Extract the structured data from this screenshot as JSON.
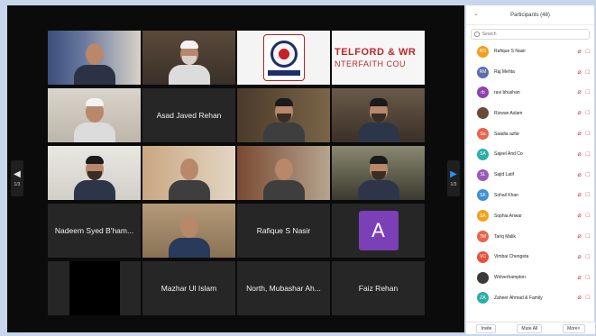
{
  "participants_panel": {
    "title": "Participants (48)",
    "search_placeholder": "Search",
    "participants": [
      {
        "initials": "RS",
        "name": "Rafique S Nasir",
        "color": "#f0a11c"
      },
      {
        "initials": "RM",
        "name": "Raj Mehta",
        "color": "#5b6ea8"
      },
      {
        "initials": "rb",
        "name": "ravi bhushan",
        "color": "#8e44ad"
      },
      {
        "initials": "",
        "name": "Rizwan Aslam",
        "color": "#6b4a3a"
      },
      {
        "initials": "Sa",
        "name": "Saadia azfar",
        "color": "#e8644a"
      },
      {
        "initials": "SA",
        "name": "Sajeel And Co",
        "color": "#2bb0a5"
      },
      {
        "initials": "SL",
        "name": "Sajid Latif",
        "color": "#9b59b6"
      },
      {
        "initials": "SK",
        "name": "Sohail Khan",
        "color": "#3f8fd6"
      },
      {
        "initials": "SA",
        "name": "Sophia Anwar",
        "color": "#f0a11c"
      },
      {
        "initials": "TM",
        "name": "Tariq Malik",
        "color": "#e8644a"
      },
      {
        "initials": "VC",
        "name": "Vimbai Chengeta",
        "color": "#e4533f"
      },
      {
        "initials": "",
        "name": "Wolverhampton",
        "color": "#3a3a3a"
      },
      {
        "initials": "ZA",
        "name": "Zaheer Ahmad & Family",
        "color": "#2bb0a5"
      }
    ],
    "footer": {
      "invite": "Invite",
      "mute_all": "Mute All",
      "more": "More"
    }
  },
  "gallery": {
    "tile_names": {
      "asad": "Asad Javed Rehan",
      "nadeem": "Nadeem Syed B'ham...",
      "rafique": "Rafique S Nasir",
      "mazhar": "Mazhar Ul Islam",
      "north": "North, Mubashar Ah...",
      "faiz": "Faiz Rehan"
    },
    "telford_line1": "TELFORD & WR",
    "telford_line2": "NTERFAITH COU",
    "avatar_letter": "A",
    "page_left": "1/3",
    "page_right": "1/3"
  },
  "colors": {
    "active_speaker": "#d3d63a",
    "nav_arrow_active": "#2e8bff",
    "mute_red": "#d8383a"
  }
}
